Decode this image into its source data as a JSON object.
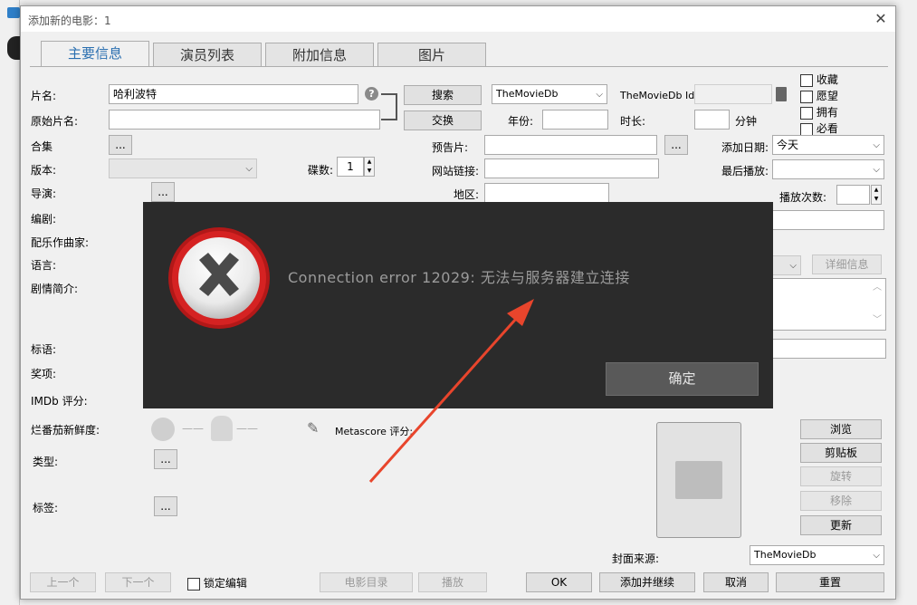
{
  "dialog": {
    "title": "添加新的电影：1",
    "close_glyph": "✕"
  },
  "tabs": [
    {
      "label": "主要信息",
      "active": true
    },
    {
      "label": "演员列表"
    },
    {
      "label": "附加信息"
    },
    {
      "label": "图片"
    }
  ],
  "form": {
    "title_label": "片名:",
    "title_value": "哈利波特",
    "original_title_label": "原始片名:",
    "collection_label": "合集",
    "version_label": "版本:",
    "discs_label": "碟数:",
    "discs_value": "1",
    "director_label": "导演:",
    "writer_label": "编剧:",
    "composer_label": "配乐作曲家:",
    "language_label": "语言:",
    "plot_label": "剧情简介:",
    "tagline_label": "标语:",
    "awards_label": "奖项:",
    "imdb_label": "IMDb 评分:",
    "rt_label": "烂番茄新鲜度:",
    "rt_dash1": "——",
    "rt_dash2": "——",
    "metascore_label": "Metascore 评分:",
    "genre_label": "类型:",
    "tags_label": "标签:",
    "ellipsis": "...",
    "search_button": "搜索",
    "swap_button": "交换",
    "source_value": "TheMovieDb",
    "tmdb_id_label": "TheMovieDb Id:",
    "year_label": "年份:",
    "runtime_label": "时长:",
    "minutes_label": "分钟",
    "trailer_label": "预告片:",
    "website_label": "网站链接:",
    "region_label": "地区:",
    "date_added_label": "添加日期:",
    "date_added_value": "今天",
    "last_played_label": "最后播放:",
    "play_count_label": "播放次数:",
    "details_button": "详细信息",
    "checks": [
      "收藏",
      "愿望",
      "拥有",
      "必看"
    ],
    "browse_button": "浏览",
    "clipboard_button": "剪贴板",
    "rotate_button": "旋转",
    "remove_button": "移除",
    "update_button": "更新",
    "cover_source_label": "封面来源:",
    "cover_source_value": "TheMovieDb"
  },
  "footer": {
    "prev_button": "上一个",
    "next_button": "下一个",
    "lock_label": "锁定编辑",
    "catalog_button": "电影目录",
    "play_button": "播放",
    "ok_button": "OK",
    "add_continue_button": "添加并继续",
    "cancel_button": "取消",
    "reset_button": "重置"
  },
  "error_dialog": {
    "message": "Connection error 12029: 无法与服务器建立连接",
    "ok_button": "确定"
  },
  "colors": {
    "error_bg": "#2b2b2b",
    "arrow": "#e8452c",
    "active_tab_text": "#2a6fb0"
  }
}
